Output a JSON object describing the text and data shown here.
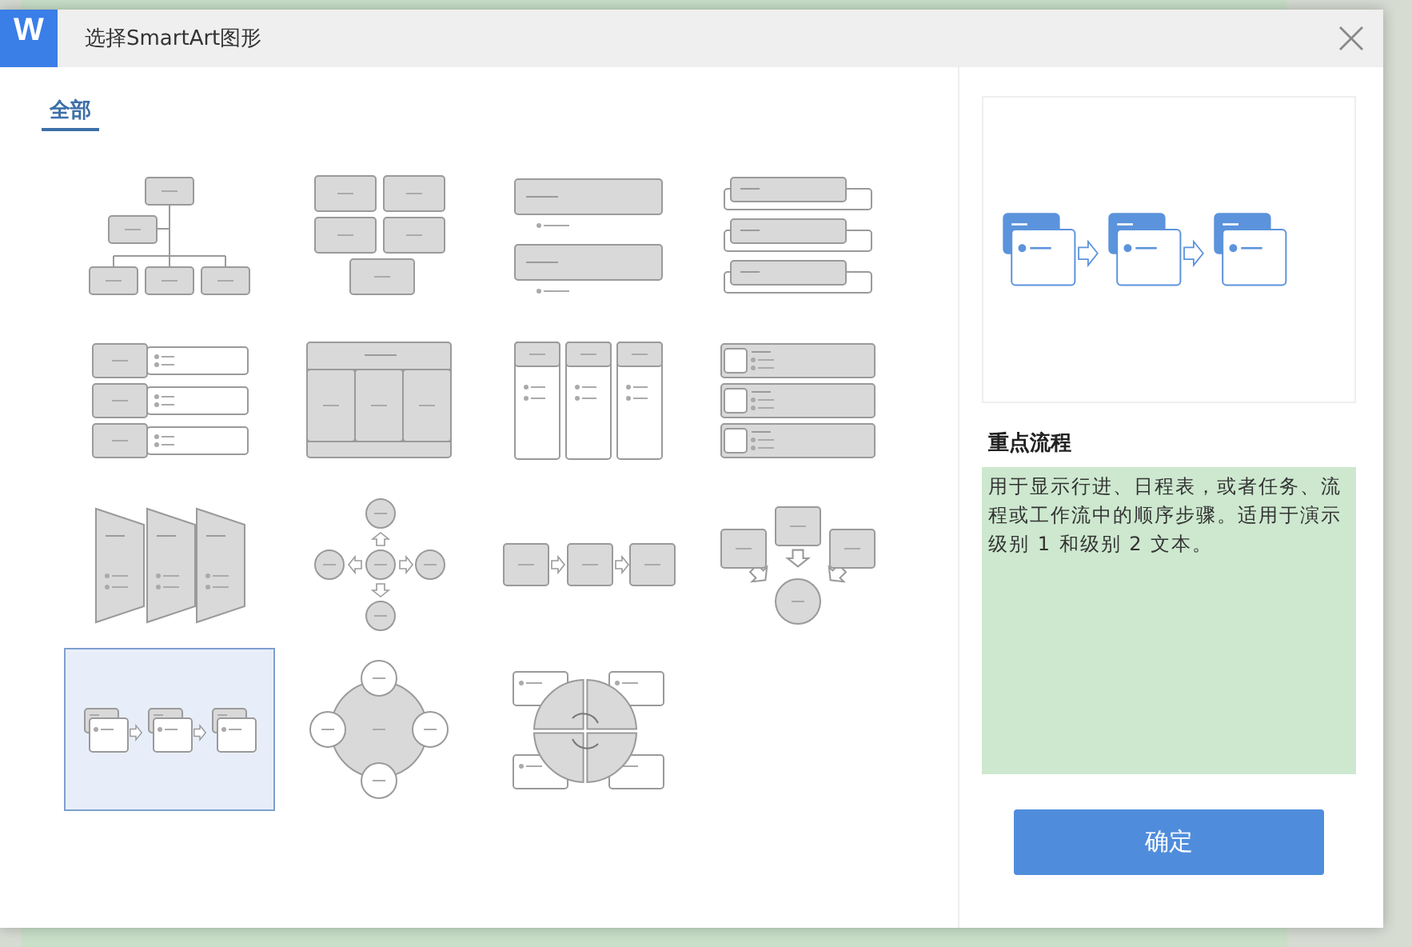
{
  "window": {
    "title": "选择SmartArt图形",
    "app_icon": "W"
  },
  "tabs": [
    {
      "label": "全部",
      "selected": true
    }
  ],
  "layouts": [
    {
      "kind": "hierarchy",
      "selected": false
    },
    {
      "kind": "grid-blocks",
      "selected": false
    },
    {
      "kind": "list-bars",
      "selected": false
    },
    {
      "kind": "stacked-tabs",
      "selected": false
    },
    {
      "kind": "label-list",
      "selected": false
    },
    {
      "kind": "table-blocks",
      "selected": false
    },
    {
      "kind": "columns",
      "selected": false
    },
    {
      "kind": "picture-list",
      "selected": false
    },
    {
      "kind": "panels",
      "selected": false
    },
    {
      "kind": "radial-arrows",
      "selected": false
    },
    {
      "kind": "process",
      "selected": false
    },
    {
      "kind": "converging",
      "selected": false
    },
    {
      "kind": "accent-process",
      "selected": true
    },
    {
      "kind": "circle-nodes",
      "selected": false
    },
    {
      "kind": "cycle-matrix",
      "selected": false
    }
  ],
  "preview": {
    "kind": "accent-process",
    "name": "重点流程",
    "description": "用于显示行进、日程表，或者任务、流程或工作流中的顺序步骤。适用于演示级别 1 和级别 2 文本。"
  },
  "buttons": [
    "确定"
  ]
}
